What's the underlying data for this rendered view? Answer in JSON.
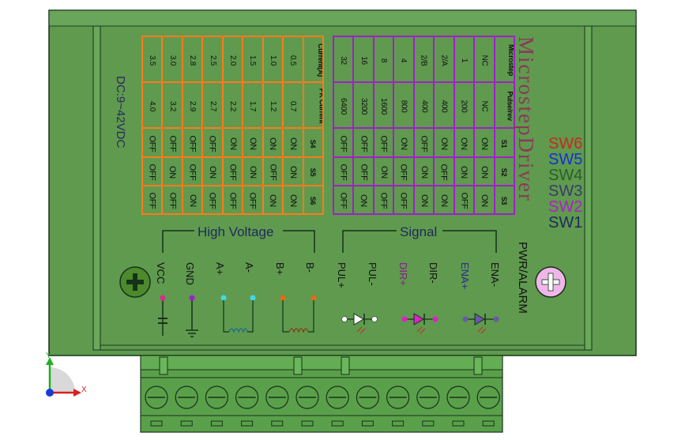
{
  "title": "MicrostepDriver",
  "voltage": "DC:9~42VDC",
  "switch_labels": [
    {
      "text": "SW6",
      "color": "#c8281e"
    },
    {
      "text": "SW5",
      "color": "#1a2fd0"
    },
    {
      "text": "SW4",
      "color": "#2a5e2a"
    },
    {
      "text": "SW3",
      "color": "#3a3c6a"
    },
    {
      "text": "SW2",
      "color": "#b01ec8"
    },
    {
      "text": "SW1",
      "color": "#1f2a5a"
    }
  ],
  "current_table": {
    "headers": [
      "Current(A)",
      "PK Current",
      "S4",
      "S5",
      "S6"
    ],
    "rows": [
      [
        "0.5",
        "0.7",
        "ON",
        "ON",
        "ON"
      ],
      [
        "1.0",
        "1.2",
        "ON",
        "OFF",
        "ON"
      ],
      [
        "1.5",
        "1.7",
        "ON",
        "ON",
        "OFF"
      ],
      [
        "2.0",
        "2.2",
        "ON",
        "OFF",
        "OFF"
      ],
      [
        "2.5",
        "2.7",
        "OFF",
        "ON",
        "OFF"
      ],
      [
        "2.8",
        "2.9",
        "OFF",
        "OFF",
        "ON"
      ],
      [
        "3.0",
        "3.2",
        "OFF",
        "ON",
        "OFF"
      ],
      [
        "3.5",
        "4.0",
        "OFF",
        "OFF",
        "OFF"
      ]
    ]
  },
  "microstep_table": {
    "headers": [
      "Microstep",
      "Pulse/rev",
      "S1",
      "S2",
      "S3"
    ],
    "rows": [
      [
        "NC",
        "NC",
        "ON",
        "ON",
        "ON"
      ],
      [
        "1",
        "200",
        "ON",
        "ON",
        "OFF"
      ],
      [
        "2/A",
        "400",
        "ON",
        "OFF",
        "ON"
      ],
      [
        "2/B",
        "400",
        "OFF",
        "ON",
        "ON"
      ],
      [
        "4",
        "800",
        "ON",
        "OFF",
        "OFF"
      ],
      [
        "8",
        "1600",
        "OFF",
        "ON",
        "OFF"
      ],
      [
        "16",
        "3200",
        "OFF",
        "OFF",
        "ON"
      ],
      [
        "32",
        "6400",
        "OFF",
        "OFF",
        "OFF"
      ]
    ]
  },
  "groups": {
    "high_voltage": "High Voltage",
    "signal": "Signal"
  },
  "pins": [
    "VCC",
    "GND",
    "A+",
    "A-",
    "B+",
    "B-",
    "PUL+",
    "PUL-",
    "DIR+",
    "DIR-",
    "ENA+",
    "ENA-"
  ],
  "led_label": "PWR/ALARM",
  "axes": {
    "x": "X",
    "y": "Y"
  },
  "colors": {
    "board": "#5f9a4f",
    "board_edge": "#16321a",
    "orange": "#ff7a1a",
    "purple": "#a020c8",
    "connector": "#5aa04a",
    "screw_left": "#4c8a2c",
    "screw_right": "#f0b6ea"
  }
}
